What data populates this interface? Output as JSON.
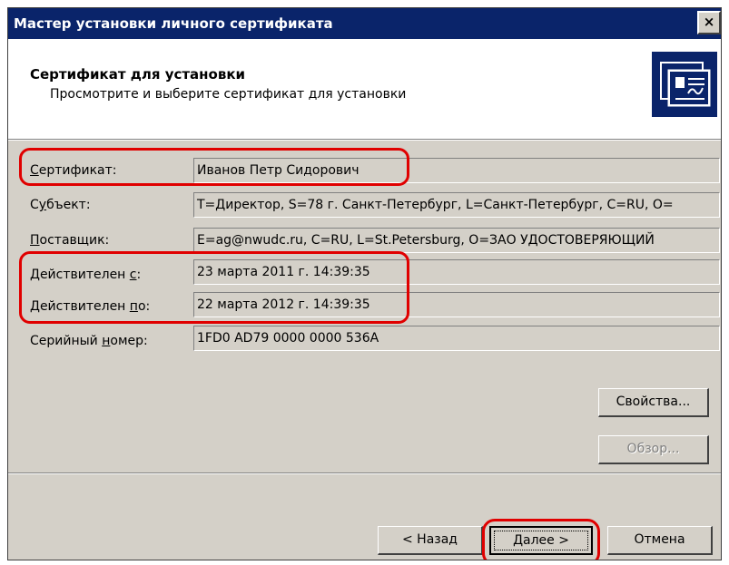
{
  "window": {
    "title": "Мастер установки личного сертификата",
    "close_label": "×"
  },
  "header": {
    "title": "Сертификат для установки",
    "subtitle": "Просмотрите и выберите сертификат для установки",
    "icon": "certificate-icon"
  },
  "fields": [
    {
      "label": "Сертификат:",
      "value": "Иванов Петр Сидорович"
    },
    {
      "label": "Субъект:",
      "value": "T=Директор, S=78 г. Санкт-Петербург, L=Санкт-Петербург, C=RU, O="
    },
    {
      "label": "Поставщик:",
      "value": "E=ag@nwudc.ru, C=RU, L=St.Petersburg, O=ЗАО УДОСТОВЕРЯЮЩИЙ"
    },
    {
      "label": "Действителен с:",
      "value": "23 марта 2011 г. 14:39:35"
    },
    {
      "label": "Действителен по:",
      "value": "22 марта 2012 г. 14:39:35"
    },
    {
      "label": "Серийный номер:",
      "value": "1FD0 AD79 0000 0000 536A"
    }
  ],
  "buttons": {
    "properties": "Свойства...",
    "browse": "Обзор...",
    "back": "< Назад",
    "next": "Далее >",
    "cancel": "Отмена"
  },
  "colors": {
    "titlebar": "#0a246a",
    "dialog": "#d4d0c8",
    "highlight": "#e00000"
  }
}
